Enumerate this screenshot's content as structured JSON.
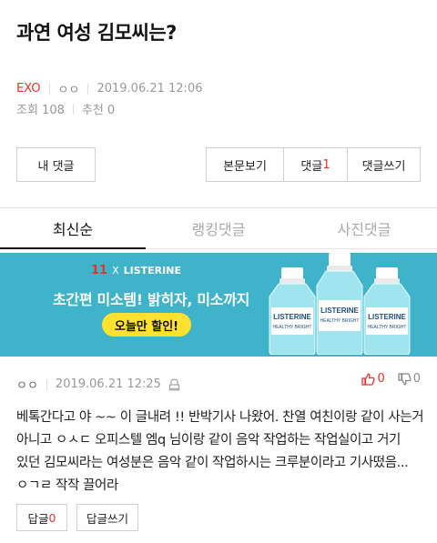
{
  "post": {
    "title": "과연 여성 김모씨는?",
    "category": "EXO",
    "author": "ㅇㅇ",
    "datetime": "2019.06.21 12:06",
    "views": "조회 108",
    "recommends": "추천 0"
  },
  "actions": {
    "my_comments": "내 댓글",
    "view_post": "본문보기",
    "comments_label": "댓글",
    "comments_count": "1",
    "write_comment": "댓글쓰기"
  },
  "tabs": [
    {
      "label": "최신순",
      "active": true
    },
    {
      "label": "랭킹댓글",
      "active": false
    },
    {
      "label": "사진댓글",
      "active": false
    }
  ],
  "banner": {
    "brand_left": "11",
    "brand_x": "X",
    "brand_right": "LISTERINE",
    "headline": "초간편 미소템! 밝히자, 미소까지",
    "cta": "오늘만 할인!",
    "bottle_brand": "LISTERINE",
    "bottle_variant": "HEALTHY BRIGHT"
  },
  "comment": {
    "author": "ㅇㅇ",
    "datetime": "2019.06.21 12:25",
    "upvotes": "0",
    "downvotes": "0",
    "body": "베톡간다고 야 ~~ 이 글내려 !! 반박기사 나왔어. 찬열 여친이랑 같이 사는거 아니고 ㅇㅅㄷ 오피스텔 엠q 님이랑 같이 음악 작업하는 작업실이고 거기 있던 김모씨라는 여성분은 음악 같이 작업하시는 크루분이라고 기사떴음... ㅇㄱㄹ 작작 끌어라",
    "reply_label": "답글",
    "reply_count": "0",
    "write_reply": "답글쓰기"
  },
  "colors": {
    "accent": "#e6322b",
    "banner_bg": "#3eb3ca",
    "cta_bg": "#ffe230"
  }
}
